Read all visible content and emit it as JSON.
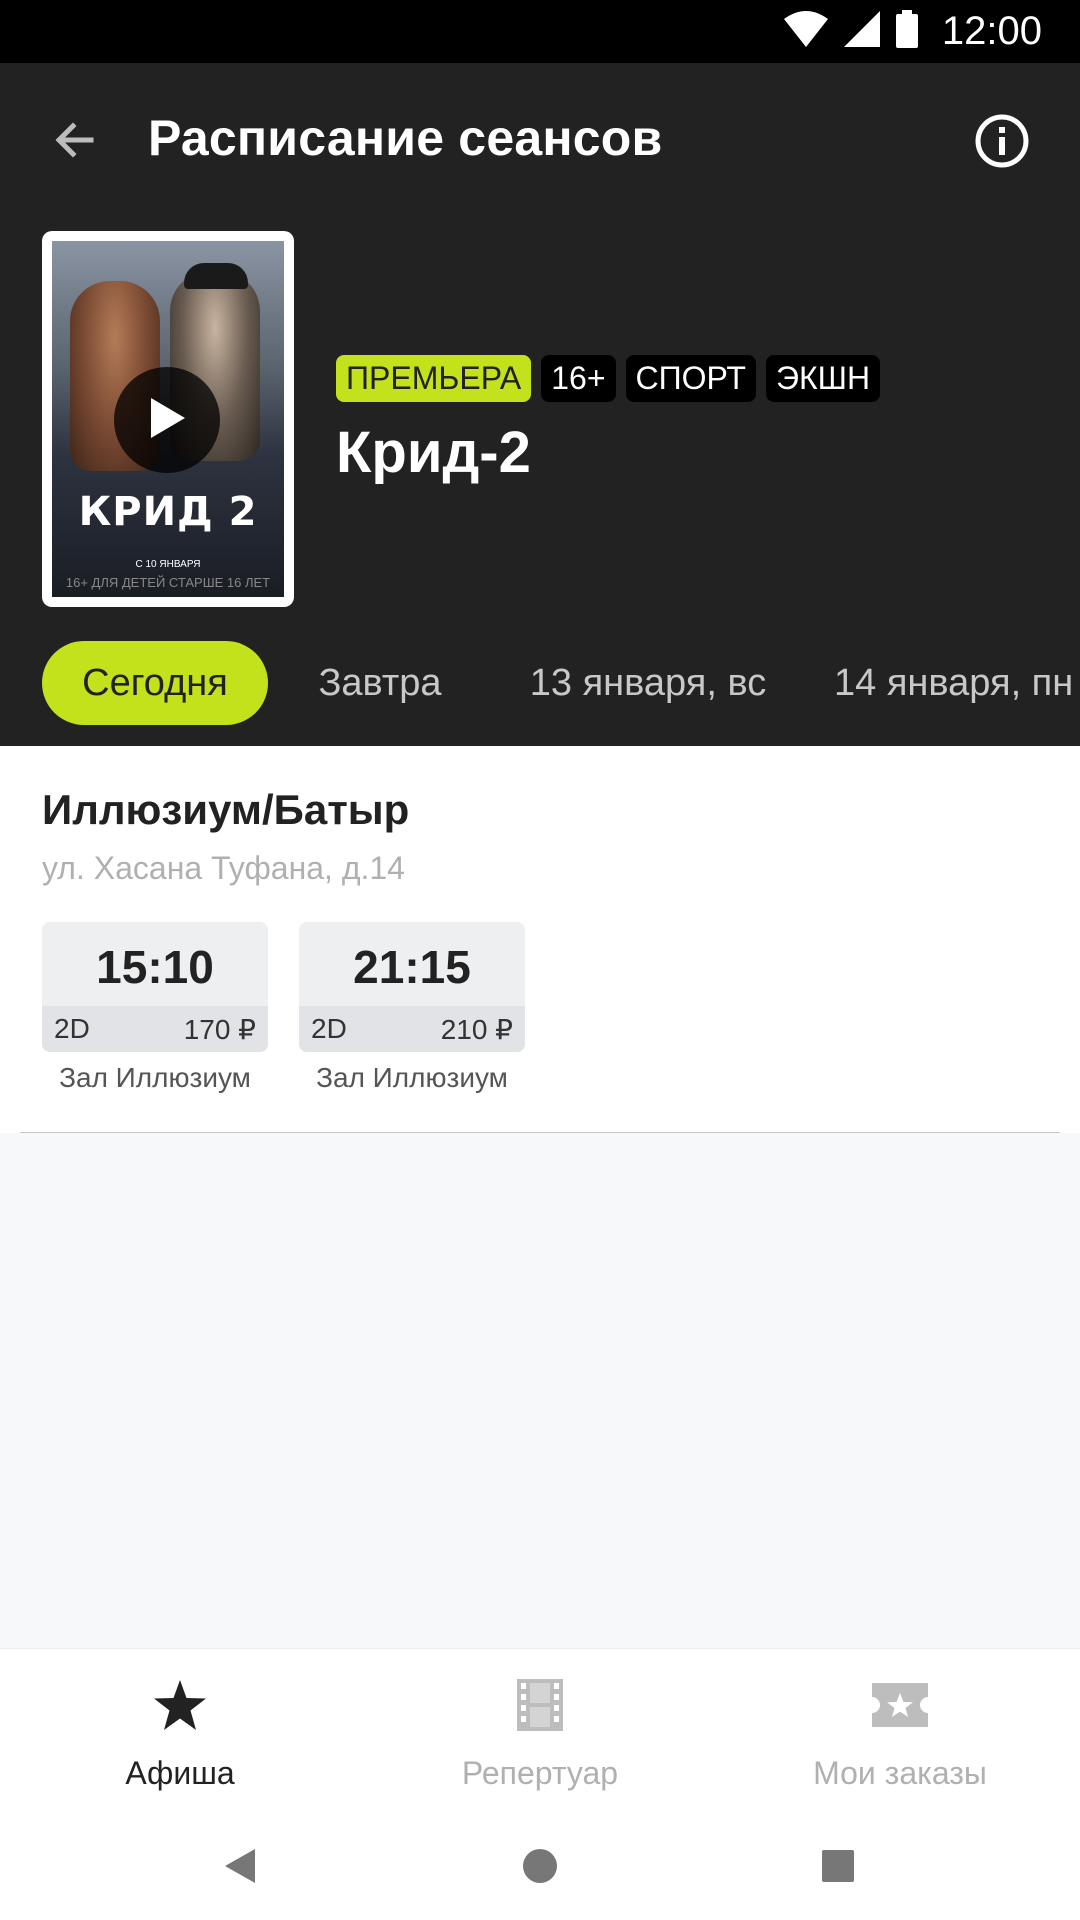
{
  "status_bar": {
    "time": "12:00",
    "icons": [
      "wifi-icon",
      "signal-icon",
      "battery-icon"
    ]
  },
  "toolbar": {
    "title": "Расписание сеансов",
    "back_icon": "arrow-left-icon",
    "info_icon": "info-icon"
  },
  "movie": {
    "poster": {
      "title": "КРИД 2",
      "date": "С 10 ЯНВАРЯ",
      "age": "16+ ДЛЯ ДЕТЕЙ СТАРШЕ 16 ЛЕТ",
      "play_icon": "play-icon"
    },
    "tags": [
      "ПРЕМЬЕРА",
      "16+",
      "СПОРТ",
      "ЭКШН"
    ],
    "title": "Крид-2"
  },
  "dates": [
    {
      "label": "Сегодня",
      "active": true
    },
    {
      "label": "Завтра",
      "active": false
    },
    {
      "label": "13 января, вс",
      "active": false
    },
    {
      "label": "14 января, пн",
      "active": false
    }
  ],
  "cinema": {
    "name": "Иллюзиум/Батыр",
    "address": "ул. Хасана Туфана, д.14",
    "sessions": [
      {
        "time": "15:10",
        "format": "2D",
        "price": "170 ₽",
        "hall": "Зал Иллюзиум"
      },
      {
        "time": "21:15",
        "format": "2D",
        "price": "210 ₽",
        "hall": "Зал Иллюзиум"
      }
    ]
  },
  "bottom_nav": [
    {
      "label": "Афиша",
      "icon": "star-icon",
      "active": true
    },
    {
      "label": "Репертуар",
      "icon": "film-icon",
      "active": false
    },
    {
      "label": "Мои заказы",
      "icon": "ticket-icon",
      "active": false
    }
  ],
  "system_nav": [
    "back-triangle-icon",
    "home-circle-icon",
    "recents-square-icon"
  ],
  "colors": {
    "accent": "#c3e21c",
    "header_bg": "#222222",
    "status_bar_bg": "#000000"
  }
}
